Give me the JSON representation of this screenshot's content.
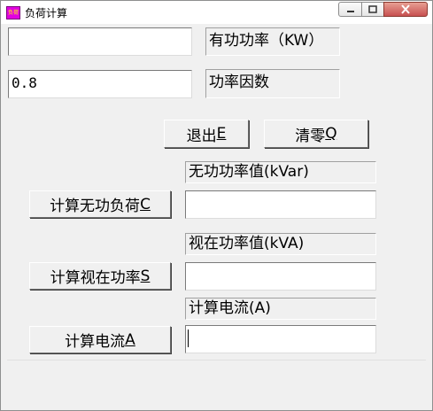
{
  "window": {
    "title": "负荷计算",
    "app_icon_text": "负荷"
  },
  "caption_buttons": {
    "minimize": "−",
    "maximize": "□",
    "close": "✕"
  },
  "inputs": {
    "active_power": {
      "value": ""
    },
    "power_factor": {
      "value": "0.8"
    },
    "reactive_power": {
      "value": ""
    },
    "apparent_power": {
      "value": ""
    },
    "current": {
      "value": ""
    }
  },
  "labels": {
    "active_power": "有功功率（KW）",
    "power_factor": "功率因数",
    "reactive_power": "无功功率值(kVar)",
    "apparent_power": "视在功率值(kVA)",
    "current": "计算电流(A)"
  },
  "buttons": {
    "exit": {
      "label": "退出",
      "accel": "E"
    },
    "clear": {
      "label": "清零",
      "accel": "Q"
    },
    "calc_reactive": {
      "label": "计算无功负荷",
      "accel": "C"
    },
    "calc_apparent": {
      "label": "计算视在功率",
      "accel": "S"
    },
    "calc_current": {
      "label": "计算电流",
      "accel": "A"
    }
  }
}
